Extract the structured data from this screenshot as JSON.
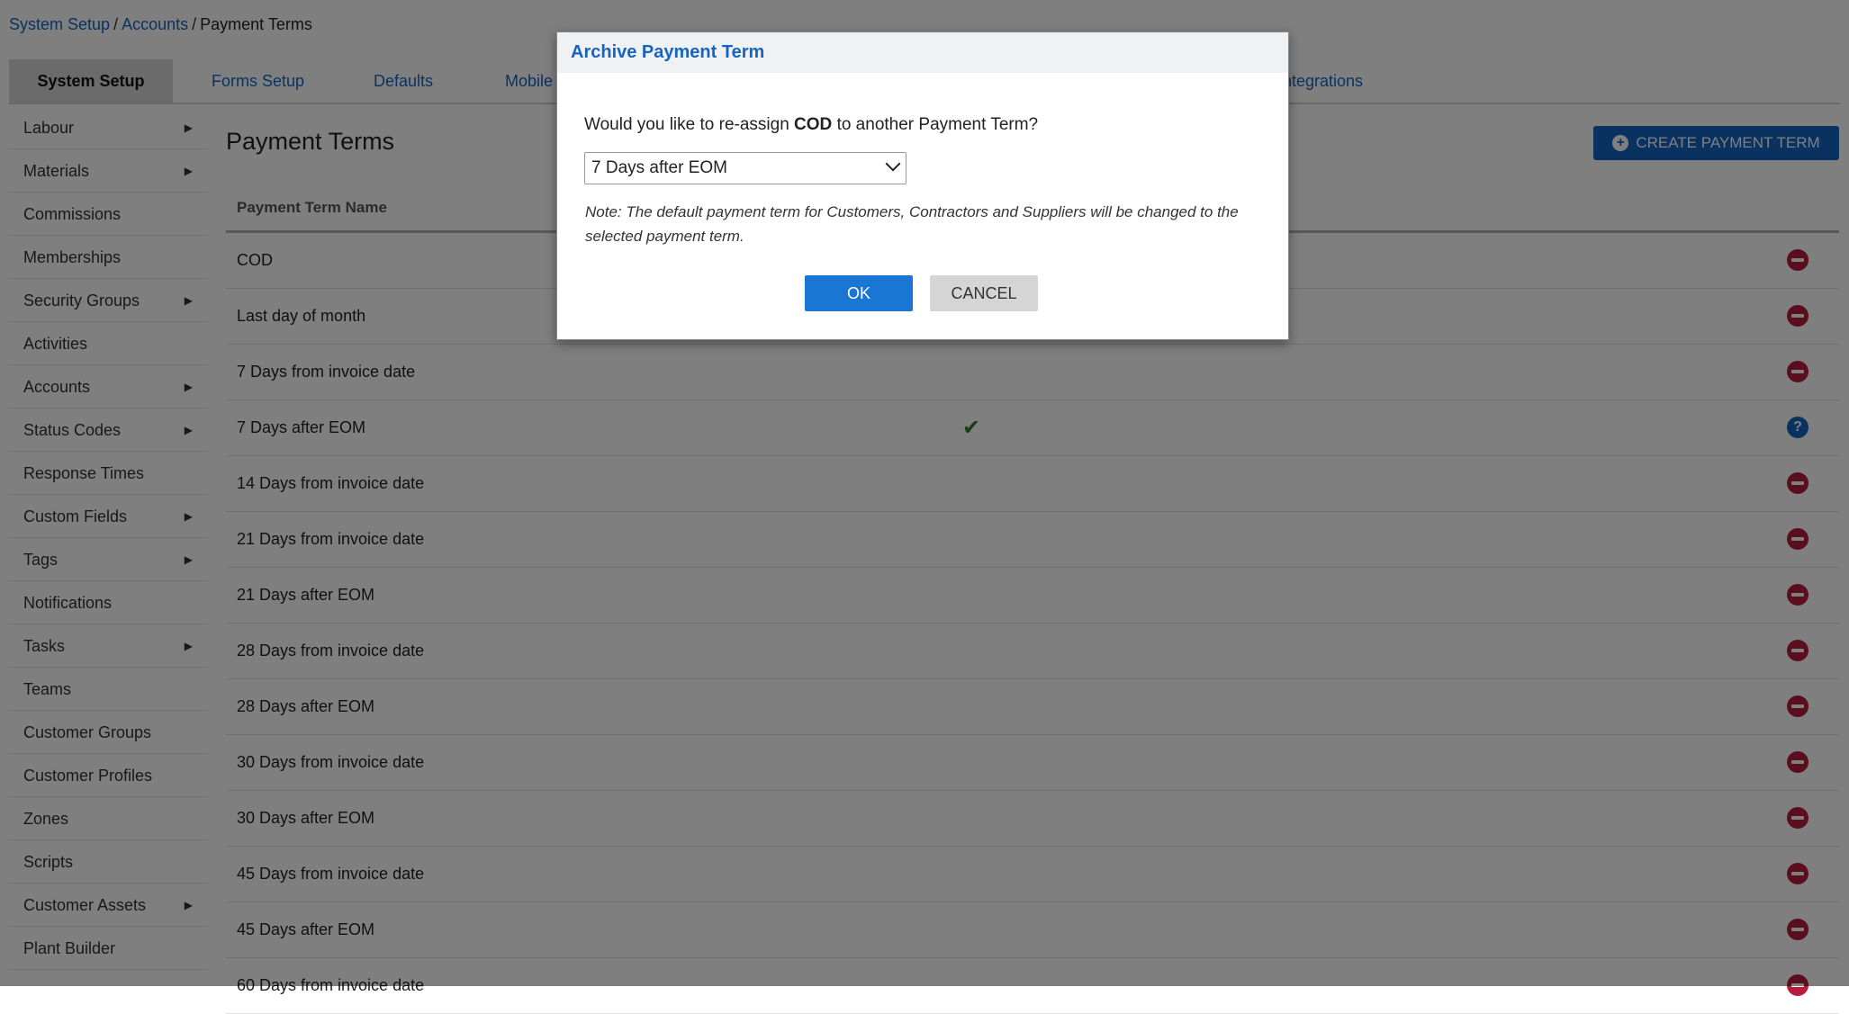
{
  "breadcrumb": {
    "root": "System Setup",
    "parent": "Accounts",
    "current": "Payment Terms",
    "separator": "/"
  },
  "tabs": [
    "System Setup",
    "Forms Setup",
    "Defaults",
    "Mobile",
    "Integrations"
  ],
  "sidebar": {
    "items": [
      {
        "label": "Labour",
        "arrow": "▶"
      },
      {
        "label": "Materials",
        "arrow": "▶"
      },
      {
        "label": "Commissions",
        "arrow": ""
      },
      {
        "label": "Memberships",
        "arrow": ""
      },
      {
        "label": "Security Groups",
        "arrow": "▶"
      },
      {
        "label": "Activities",
        "arrow": ""
      },
      {
        "label": "Accounts",
        "arrow": "▶"
      },
      {
        "label": "Status Codes",
        "arrow": "▶"
      },
      {
        "label": "Response Times",
        "arrow": ""
      },
      {
        "label": "Custom Fields",
        "arrow": "▶"
      },
      {
        "label": "Tags",
        "arrow": "▶"
      },
      {
        "label": "Notifications",
        "arrow": ""
      },
      {
        "label": "Tasks",
        "arrow": "▶"
      },
      {
        "label": "Teams",
        "arrow": ""
      },
      {
        "label": "Customer Groups",
        "arrow": ""
      },
      {
        "label": "Customer Profiles",
        "arrow": ""
      },
      {
        "label": "Zones",
        "arrow": ""
      },
      {
        "label": "Scripts",
        "arrow": ""
      },
      {
        "label": "Customer Assets",
        "arrow": "▶"
      },
      {
        "label": "Plant Builder",
        "arrow": ""
      }
    ]
  },
  "main": {
    "title": "Payment Terms",
    "create_label": "CREATE PAYMENT TERM",
    "create_icon": "+",
    "column_header": "Payment Term Name",
    "rows": [
      {
        "name": "COD",
        "default": false,
        "action": "archive"
      },
      {
        "name": "Last day of month",
        "default": false,
        "action": "archive"
      },
      {
        "name": "7 Days from invoice date",
        "default": false,
        "action": "archive"
      },
      {
        "name": "7 Days after EOM",
        "default": true,
        "action": "help"
      },
      {
        "name": "14 Days from invoice date",
        "default": false,
        "action": "archive"
      },
      {
        "name": "21 Days from invoice date",
        "default": false,
        "action": "archive"
      },
      {
        "name": "21 Days after EOM",
        "default": false,
        "action": "archive"
      },
      {
        "name": "28 Days from invoice date",
        "default": false,
        "action": "archive"
      },
      {
        "name": "28 Days after EOM",
        "default": false,
        "action": "archive"
      },
      {
        "name": "30 Days from invoice date",
        "default": false,
        "action": "archive"
      },
      {
        "name": "30 Days after EOM",
        "default": false,
        "action": "archive"
      },
      {
        "name": "45 Days from invoice date",
        "default": false,
        "action": "archive"
      },
      {
        "name": "45 Days after EOM",
        "default": false,
        "action": "archive"
      },
      {
        "name": "60 Days from invoice date",
        "default": false,
        "action": "archive"
      }
    ],
    "check_glyph": "✔",
    "help_glyph": "?"
  },
  "modal": {
    "title": "Archive Payment Term",
    "question_prefix": "Would you like to re-assign",
    "question_term": "COD",
    "question_suffix": "to another Payment Term?",
    "selected_option": "7 Days after EOM",
    "note": "Note: The default payment term for Customers, Contractors and Suppliers will be changed to the selected payment term.",
    "ok_label": "OK",
    "cancel_label": "CANCEL"
  },
  "colors": {
    "accent": "#1565c0",
    "archive": "#b71c3c",
    "check": "#2e7d32"
  }
}
